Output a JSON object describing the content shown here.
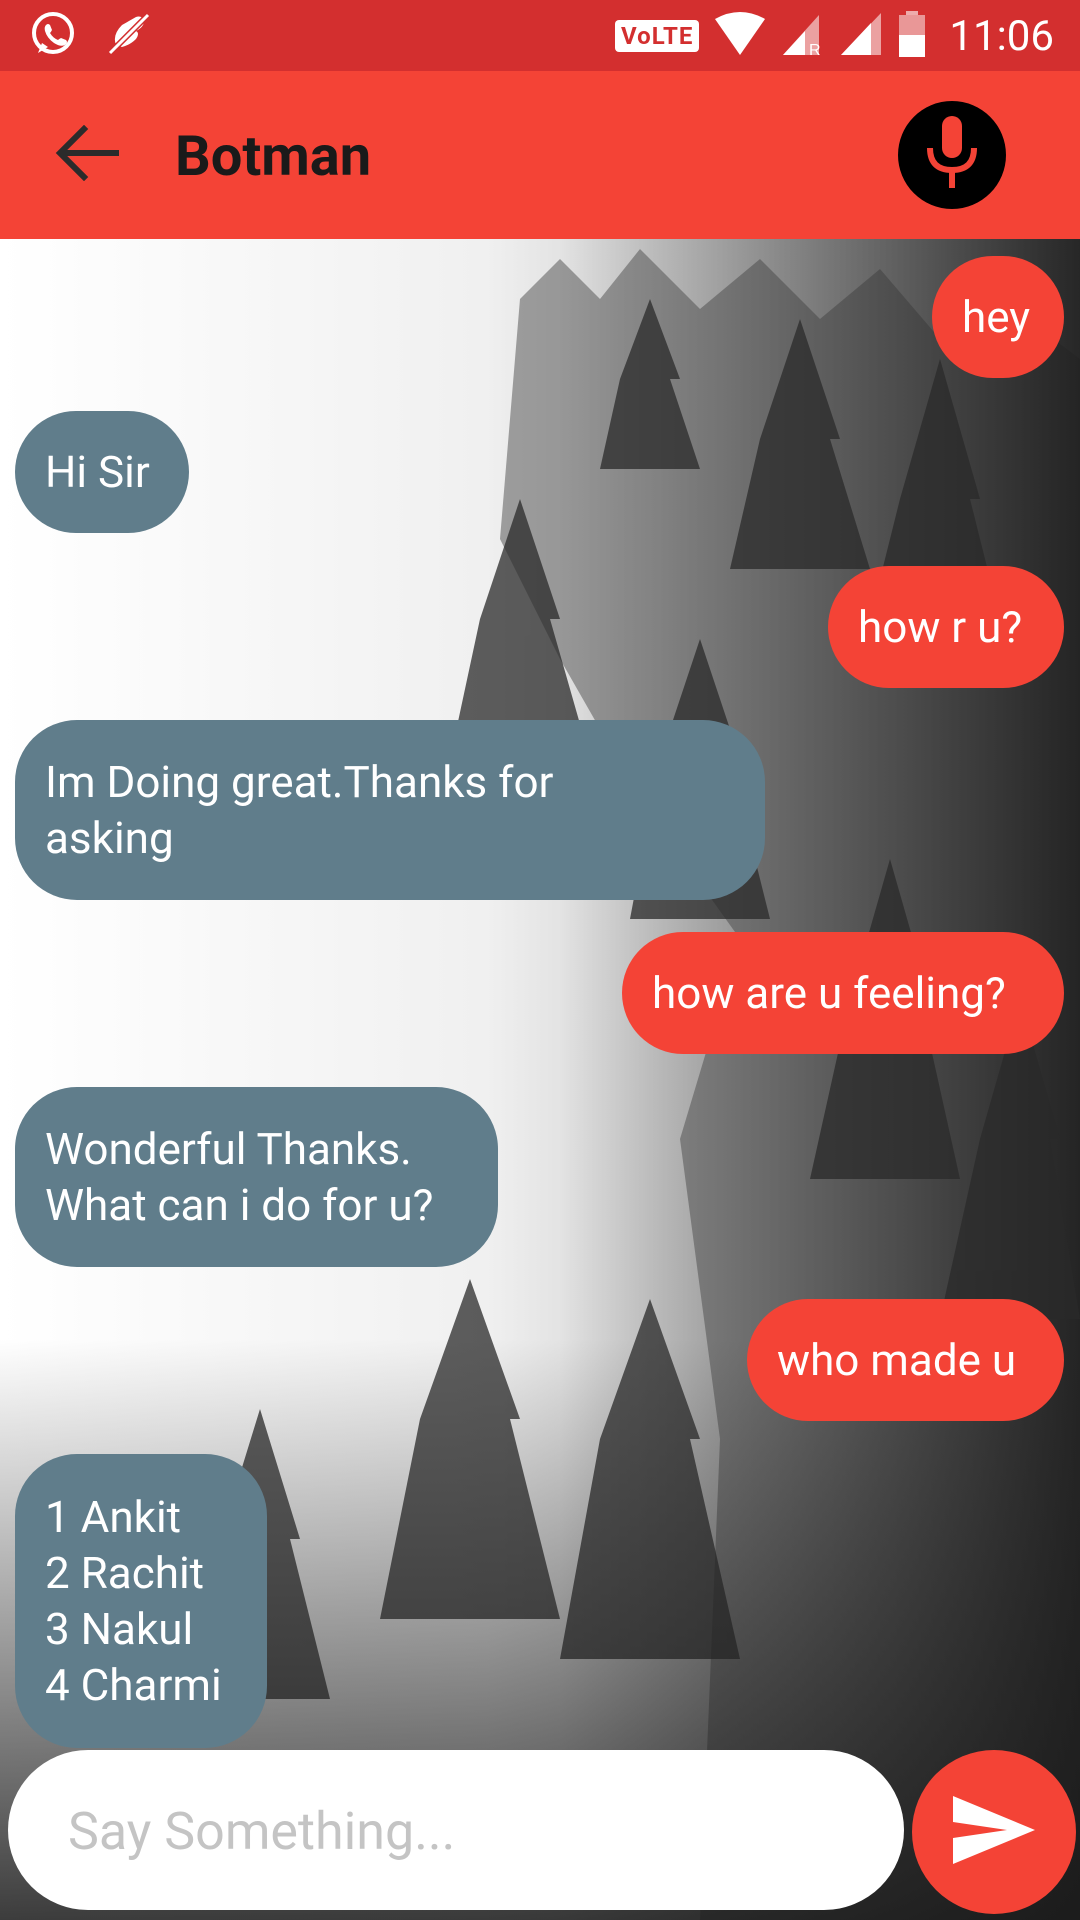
{
  "status_bar": {
    "icons_left": [
      "whatsapp-icon",
      "muted-mic-icon"
    ],
    "volte_label": "VoLTE",
    "icons_right": [
      "wifi-icon",
      "signal-roaming-icon",
      "signal-icon",
      "battery-icon"
    ],
    "time": "11:06"
  },
  "app_bar": {
    "title": "Botman",
    "back_icon": "arrow-back-icon",
    "mic_icon": "mic-icon"
  },
  "messages": [
    {
      "sender": "user",
      "text": "hey"
    },
    {
      "sender": "bot",
      "text": "Hi Sir"
    },
    {
      "sender": "user",
      "text": "how r u?"
    },
    {
      "sender": "bot",
      "text": "Im Doing great.Thanks for\nasking"
    },
    {
      "sender": "user",
      "text": "how are u feeling?"
    },
    {
      "sender": "bot",
      "text": "Wonderful Thanks.\nWhat can i do for u?"
    },
    {
      "sender": "user",
      "text": "who made u"
    },
    {
      "sender": "bot",
      "text": "1 Ankit\n2 Rachit\n3 Nakul\n4 Charmi"
    }
  ],
  "input": {
    "placeholder": "Say Something...",
    "value": ""
  },
  "send_icon": "send-icon",
  "colors": {
    "status_bar": "#d32f2f",
    "app_bar": "#f44336",
    "user_bubble": "#f44336",
    "bot_bubble": "#607d8b"
  }
}
